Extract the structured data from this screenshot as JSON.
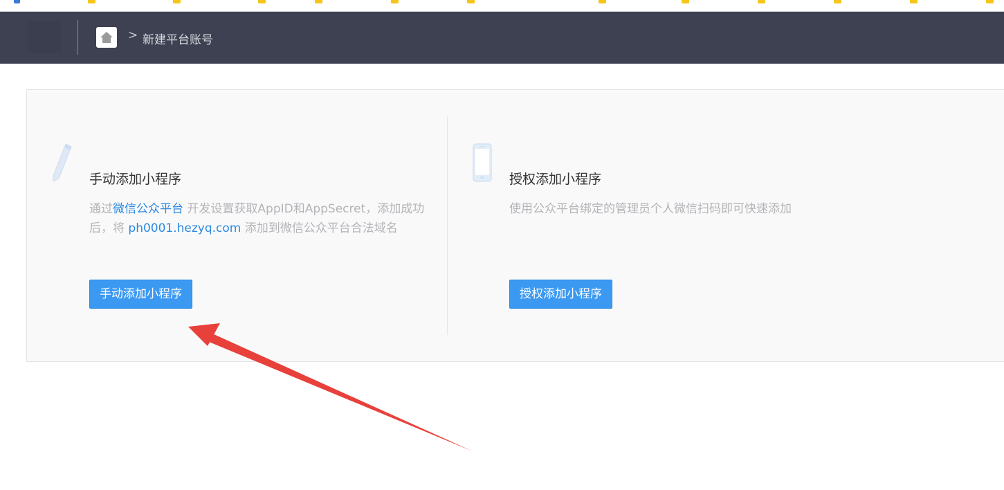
{
  "breadcrumb": {
    "separator": ">",
    "current": "新建平台账号"
  },
  "icons": {
    "home": "home-icon",
    "manual": "pencil-icon",
    "authorize": "phone-icon"
  },
  "cards": {
    "manual": {
      "title": "手动添加小程序",
      "desc_prefix": "通过",
      "desc_link": "微信公众平台",
      "desc_mid": " 开发设置获取AppID和AppSecret，添加成功后，将 ",
      "desc_domain": "ph0001.hezyq.com",
      "desc_suffix": " 添加到微信公众平台合法域名",
      "button": "手动添加小程序"
    },
    "authorize": {
      "title": "授权添加小程序",
      "desc": "使用公众平台绑定的管理员个人微信扫码即可快速添加",
      "button": "授权添加小程序"
    }
  },
  "colors": {
    "topbar": "#3d4151",
    "primary": "#3b99f2",
    "link": "#2b88e0",
    "annotation": "#e8403a"
  }
}
